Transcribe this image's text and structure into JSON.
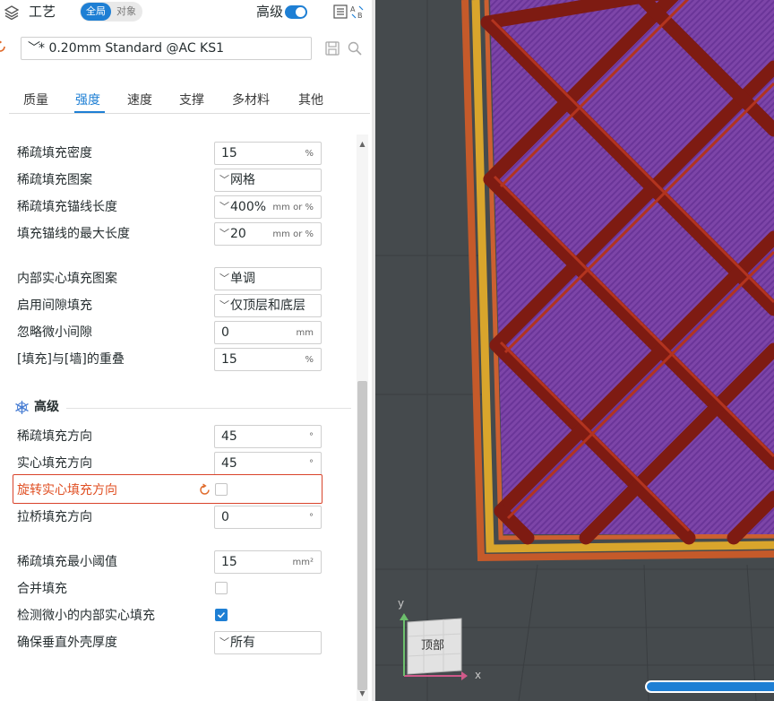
{
  "header": {
    "title": "工艺",
    "scope_global": "全局",
    "scope_object": "对象",
    "advanced_label": "高级",
    "advanced_enabled": true
  },
  "preset": {
    "value": "* 0.20mm Standard @AC KS1"
  },
  "tabs": [
    {
      "label": "质量",
      "active": false
    },
    {
      "label": "强度",
      "active": true
    },
    {
      "label": "速度",
      "active": false
    },
    {
      "label": "支撑",
      "active": false
    },
    {
      "label": "多材料",
      "active": false
    },
    {
      "label": "其他",
      "active": false
    }
  ],
  "settings": {
    "sparse_density": {
      "label": "稀疏填充密度",
      "value": "15",
      "unit": "%"
    },
    "sparse_pattern": {
      "label": "稀疏填充图案",
      "value": "网格"
    },
    "anchor_length": {
      "label": "稀疏填充锚线长度",
      "value": "400%",
      "unit": "mm or %"
    },
    "anchor_max": {
      "label": "填充锚线的最大长度",
      "value": "20",
      "unit": "mm or %"
    },
    "internal_solid_pattern": {
      "label": "内部实心填充图案",
      "value": "单调"
    },
    "gap_fill": {
      "label": "启用间隙填充",
      "value": "仅顶层和底层"
    },
    "filter_gaps": {
      "label": "忽略微小间隙",
      "value": "0",
      "unit": "mm"
    },
    "infill_wall_overlap": {
      "label": "[填充]与[墙]的重叠",
      "value": "15",
      "unit": "%"
    }
  },
  "advanced": {
    "title": "高级",
    "sparse_direction": {
      "label": "稀疏填充方向",
      "value": "45",
      "unit": "°"
    },
    "solid_direction": {
      "label": "实心填充方向",
      "value": "45",
      "unit": "°"
    },
    "rotate_solid": {
      "label": "旋转实心填充方向",
      "checked": false
    },
    "bridge_direction": {
      "label": "拉桥填充方向",
      "value": "0",
      "unit": "°"
    },
    "sparse_min_threshold": {
      "label": "稀疏填充最小阈值",
      "value": "15",
      "unit": "mm²"
    },
    "combine_infill": {
      "label": "合并填充",
      "checked": false
    },
    "detect_narrow_solid": {
      "label": "检测微小的内部实心填充",
      "checked": true
    },
    "ensure_vertical_shell": {
      "label": "确保垂直外壳厚度",
      "value": "所有"
    }
  },
  "viewport": {
    "view_cube_label": "顶部",
    "axis_x": "x",
    "axis_y": "y",
    "progress": 1.0
  },
  "colors": {
    "accent": "#1e7fd4",
    "highlight": "#e05024",
    "infill_wall": "#8b1a12",
    "solid_top": "#7b3fa6",
    "perimeter_outer": "#d9a52c",
    "perimeter_inner": "#c55a2a",
    "bed": "#454a4d"
  }
}
